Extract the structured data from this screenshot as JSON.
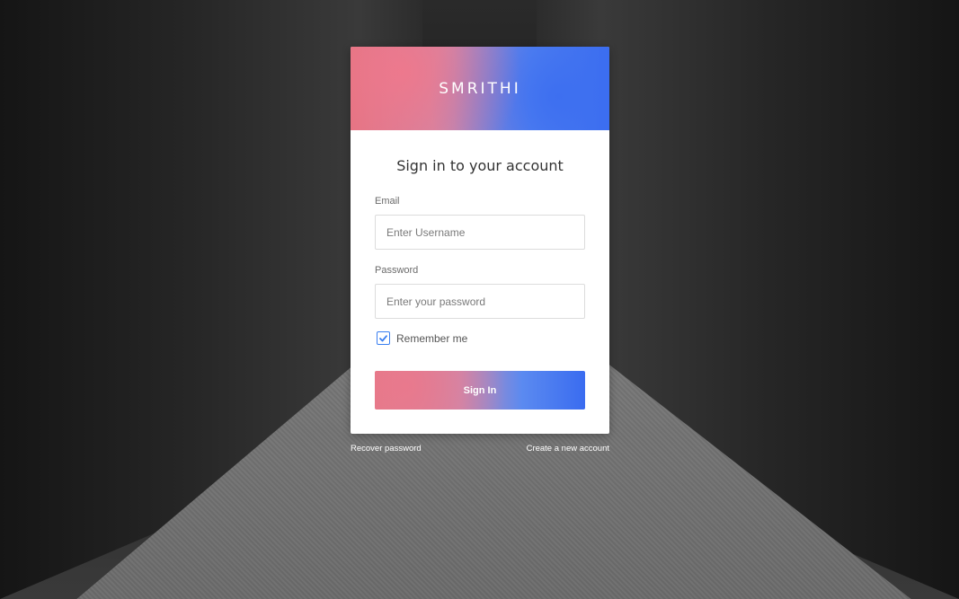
{
  "brand": "SMRITHI",
  "heading": "Sign in to your account",
  "email": {
    "label": "Email",
    "placeholder": "Enter Username"
  },
  "password": {
    "label": "Password",
    "placeholder": "Enter your password"
  },
  "remember": {
    "label": "Remember me",
    "checked": true
  },
  "signin_label": "Sign In",
  "links": {
    "recover": "Recover password",
    "create": "Create a new account"
  },
  "colors": {
    "accent_pink": "#e2727f",
    "accent_blue": "#3a6cf0",
    "checkbox": "#3a7ff0"
  }
}
